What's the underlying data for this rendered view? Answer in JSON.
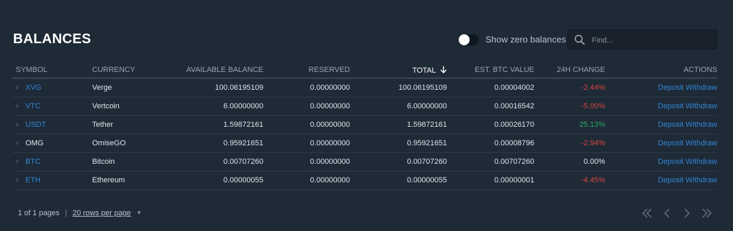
{
  "page_title": "BALANCES",
  "zero_toggle": {
    "label": "Show zero balances",
    "on": false
  },
  "search": {
    "placeholder": "Find..."
  },
  "table": {
    "headers": {
      "symbol": "SYMBOL",
      "currency": "CURRENCY",
      "available": "AVAILABLE BALANCE",
      "reserved": "RESERVED",
      "total": "TOTAL",
      "btc_value": "EST. BTC VALUE",
      "change": "24H CHANGE",
      "actions": "ACTIONS"
    },
    "sorted_column": "total",
    "sort_direction": "descending",
    "rows": [
      {
        "symbol": "XVG",
        "currency": "Verge",
        "available": "100.06195109",
        "reserved": "0.00000000",
        "total": "100.06195109",
        "btc_value": "0.00004002",
        "change": "-2.44%",
        "deposit": "Deposit",
        "withdraw": "Withdraw"
      },
      {
        "symbol": "VTC",
        "currency": "Vertcoin",
        "available": "6.00000000",
        "reserved": "0.00000000",
        "total": "6.00000000",
        "btc_value": "0.00016542",
        "change": "-5.00%",
        "deposit": "Deposit",
        "withdraw": "Withdraw"
      },
      {
        "symbol": "USDT",
        "currency": "Tether",
        "available": "1.59872161",
        "reserved": "0.00000000",
        "total": "1.59872161",
        "btc_value": "0.00026170",
        "change": "25.13%",
        "deposit": "Deposit",
        "withdraw": "Withdraw"
      },
      {
        "symbol": "OMG",
        "currency": "OmiseGO",
        "available": "0.95921651",
        "reserved": "0.00000000",
        "total": "0.95921651",
        "btc_value": "0.00008796",
        "change": "-2.94%",
        "deposit": "Deposit",
        "withdraw": "Withdraw"
      },
      {
        "symbol": "BTC",
        "currency": "Bitcoin",
        "available": "0.00707260",
        "reserved": "0.00000000",
        "total": "0.00707260",
        "btc_value": "0.00707260",
        "change": "0.00%",
        "deposit": "Deposit",
        "withdraw": "Withdraw"
      },
      {
        "symbol": "ETH",
        "currency": "Ethereum",
        "available": "0.00000055",
        "reserved": "0.00000000",
        "total": "0.00000055",
        "btc_value": "0.00000001",
        "change": "-4.45%",
        "deposit": "Deposit",
        "withdraw": "Withdraw"
      }
    ]
  },
  "pagination": {
    "page_info": "1 of 1 pages",
    "separator": "|",
    "rows_per_page": "20 rows per page"
  },
  "colors": {
    "background": "#1f2a37",
    "link": "#2f86d6",
    "negative": "#d9463e",
    "positive": "#2ba868"
  },
  "icons": {
    "search": "search-icon",
    "sort": "arrow-down-icon",
    "row_expand": "chevron-right-icon",
    "first": "double-chevron-left-icon",
    "prev": "chevron-left-icon",
    "next": "chevron-right-icon",
    "last": "double-chevron-right-icon"
  }
}
